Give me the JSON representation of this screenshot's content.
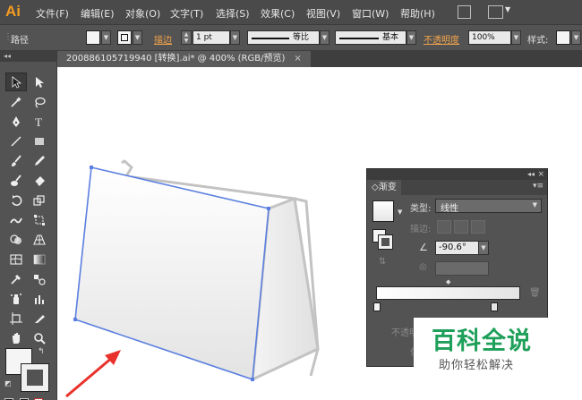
{
  "app": {
    "logo": "Ai"
  },
  "menu": [
    "文件(F)",
    "编辑(E)",
    "对象(O)",
    "文字(T)",
    "选择(S)",
    "效果(C)",
    "视图(V)",
    "窗口(W)",
    "帮助(H)"
  ],
  "controlbar": {
    "selection_label": "路径",
    "stroke_link": "描边",
    "stroke_weight": "1 pt",
    "profile_label": "等比",
    "brush_label": "基本",
    "opacity_link": "不透明度",
    "opacity_value": "100%",
    "style_label": "样式:"
  },
  "document": {
    "tab_title": "200886105719940  [转换].ai* @ 400% (RGB/预览)",
    "close_glyph": "×"
  },
  "gradient_panel": {
    "tab_label": "◇渐变",
    "collapse_glyph": "◂◂",
    "close_glyph": "×",
    "menu_glyph": "▾≡",
    "type_label": "类型:",
    "type_value": "线性",
    "stroke_label": "描边:",
    "angle_value": "-90.6°",
    "opacity_label_partial": "不透明",
    "location_label_partial": "位",
    "gradient_colors": [
      "#ffffff",
      "#e6e6e6"
    ]
  },
  "watermark": {
    "title": "百科全说",
    "subtitle": "助你轻松解决"
  },
  "colors": {
    "accent_orange": "#f29b21",
    "path_selection": "#5b7fe0",
    "arrow_red": "#e8322b",
    "watermark_green": "#1ea05a"
  },
  "tools": [
    "selection-tool",
    "direct-selection-tool",
    "magic-wand-tool",
    "lasso-tool",
    "pen-tool",
    "type-tool",
    "line-tool",
    "rectangle-tool",
    "paintbrush-tool",
    "pencil-tool",
    "blob-brush-tool",
    "eraser-tool",
    "rotate-tool",
    "scale-tool",
    "warp-tool",
    "free-transform-tool",
    "shape-builder-tool",
    "perspective-grid-tool",
    "mesh-tool",
    "gradient-tool",
    "eyedropper-tool",
    "blend-tool",
    "symbol-sprayer-tool",
    "column-graph-tool",
    "artboard-tool",
    "slice-tool",
    "hand-tool",
    "zoom-tool"
  ]
}
